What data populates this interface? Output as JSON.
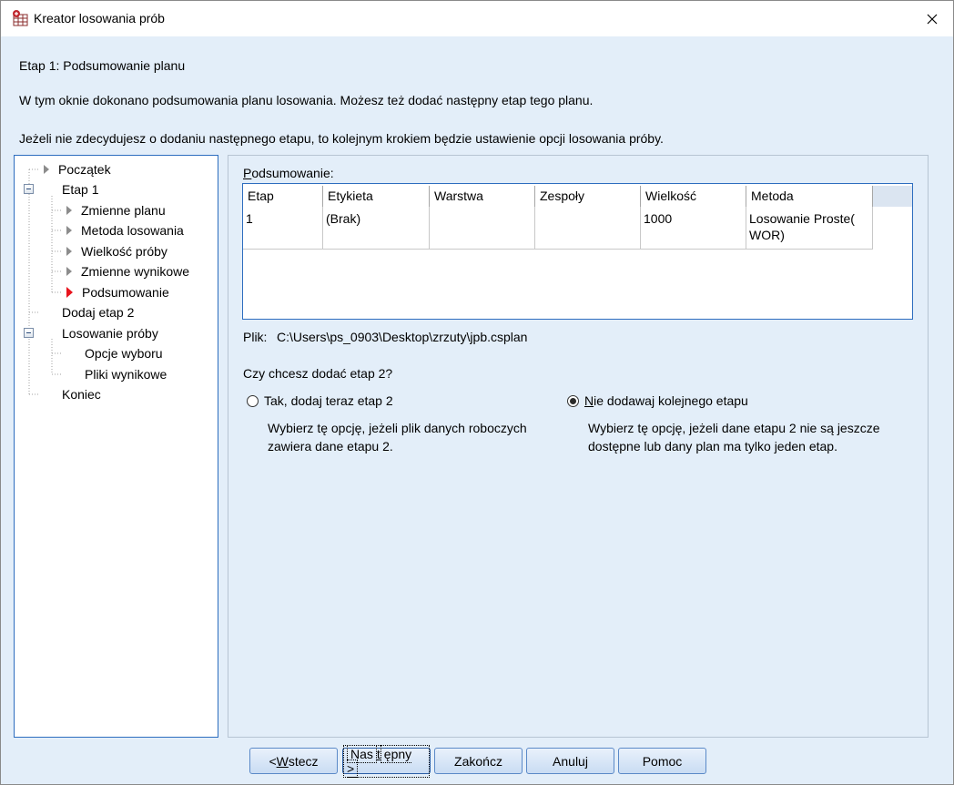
{
  "window": {
    "title": "Kreator losowania prób",
    "app_icon": "spss-table-icon",
    "close_icon": "close-icon"
  },
  "header": {
    "step_title": "Etap 1: Podsumowanie planu",
    "desc1": "W tym oknie dokonano podsumowania planu losowania. Możesz też dodać następny etap tego planu.",
    "desc2": "Jeżeli nie zdecydujesz o dodaniu następnego etapu, to kolejnym krokiem będzie ustawienie opcji losowania próby."
  },
  "tree": {
    "items": [
      {
        "label": "Początek",
        "level": 0,
        "marker": "triangle"
      },
      {
        "label": "Etap 1",
        "level": 0,
        "marker": "expander"
      },
      {
        "label": "Zmienne planu",
        "level": 1,
        "marker": "triangle"
      },
      {
        "label": "Metoda losowania",
        "level": 1,
        "marker": "triangle"
      },
      {
        "label": "Wielkość próby",
        "level": 1,
        "marker": "triangle"
      },
      {
        "label": "Zmienne wynikowe",
        "level": 1,
        "marker": "triangle"
      },
      {
        "label": "Podsumowanie",
        "level": 1,
        "marker": "current"
      },
      {
        "label": "Dodaj etap 2",
        "level": 0,
        "marker": "none"
      },
      {
        "label": "Losowanie próby",
        "level": 0,
        "marker": "expander"
      },
      {
        "label": "Opcje wyboru",
        "level": 1,
        "marker": "none"
      },
      {
        "label": "Pliki wynikowe",
        "level": 1,
        "marker": "none"
      },
      {
        "label": "Koniec",
        "level": 0,
        "marker": "none"
      }
    ]
  },
  "summary": {
    "label_u": "P",
    "label_rest": "odsumowanie:",
    "columns": [
      "Etap",
      "Etykieta",
      "Warstwa",
      "Zespoły",
      "Wielkość",
      "Metoda"
    ],
    "rows": [
      [
        "1",
        "(Brak)",
        "",
        "",
        "1000",
        "Losowanie Proste(\nWOR)"
      ]
    ]
  },
  "file": {
    "label": "Plik:",
    "path": "C:\\Users\\ps_0903\\Desktop\\zrzuty\\jpb.csplan"
  },
  "question": "Czy chcesz dodać etap 2?",
  "options": {
    "add": {
      "label": "Tak, dodaj teraz etap 2",
      "checked": false,
      "desc": "Wybierz tę opcję, jeżeli plik danych roboczych zawiera dane etapu 2."
    },
    "no_add": {
      "label_u": "N",
      "label_rest": "ie dodawaj kolejnego etapu",
      "checked": true,
      "desc": "Wybierz tę opcję, jeżeli dane etapu 2 nie są jeszcze dostępne lub dany plan ma tylko jeden etap."
    }
  },
  "buttons": {
    "back_pre": "< ",
    "back_u": "W",
    "back_rest": "stecz",
    "next_pre": "Nas",
    "next_u": "t",
    "next_rest": "ępny >",
    "finish": "Zakończ",
    "cancel": "Anuluj",
    "help": "Pomoc"
  }
}
